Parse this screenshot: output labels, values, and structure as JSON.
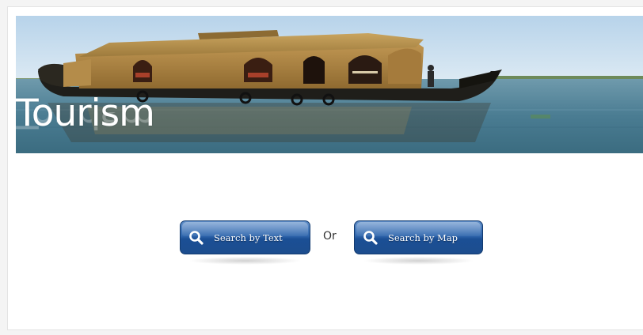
{
  "banner": {
    "title": "Tourism",
    "image": "houseboat-on-backwaters"
  },
  "search": {
    "text_button_label": "Search by Text",
    "map_button_label": "Search by Map",
    "separator": "Or",
    "icon": "search-icon"
  },
  "colors": {
    "button_blue": "#2f66ad",
    "sky": "#c9dff0",
    "water": "#4f7f96",
    "page_background": "#ffffff"
  }
}
